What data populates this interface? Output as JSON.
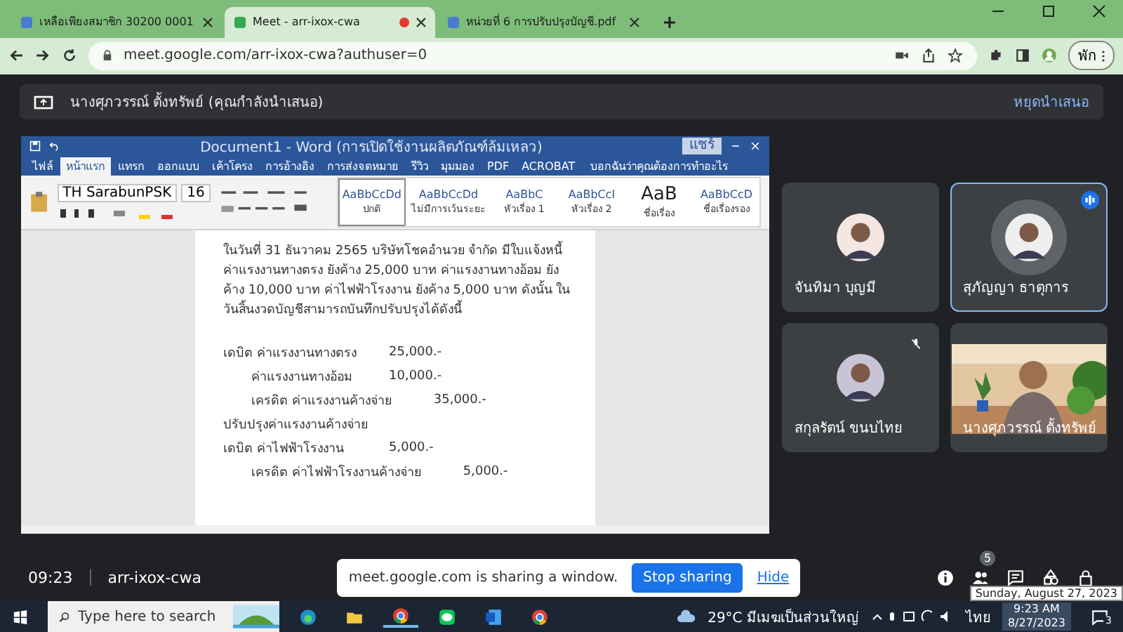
{
  "browser": {
    "tabs": [
      {
        "title": "เหลือเพียงสมาชิก 30200 0001",
        "selected": false,
        "recording": false
      },
      {
        "title": "Meet - arr-ixox-cwa",
        "selected": true,
        "recording": true
      },
      {
        "title": "หน่วยที่ 6 การปรับปรุงบัญชี.pdf",
        "selected": false,
        "recording": false
      }
    ],
    "url": "meet.google.com/arr-ixox-cwa?authuser=0",
    "profile_button": "พัก"
  },
  "presenting_banner": {
    "text": "นางศุภวรรณ์ ตั้งทรัพย์ (คุณกำลังนำเสนอ)",
    "stop": "หยุดนำเสนอ"
  },
  "word": {
    "title": "Document1 - Word (การเปิดใช้งานผลิตภัณฑ์ล้มเหลว)",
    "share_button": "แชร์",
    "tabs": [
      {
        "label": "ไฟล์",
        "selected": false
      },
      {
        "label": "หน้าแรก",
        "selected": true
      },
      {
        "label": "แทรก",
        "selected": false
      },
      {
        "label": "ออกแบบ",
        "selected": false
      },
      {
        "label": "เค้าโครง",
        "selected": false
      },
      {
        "label": "การอ้างอิง",
        "selected": false
      },
      {
        "label": "การส่งจดหมาย",
        "selected": false
      },
      {
        "label": "รีวิว",
        "selected": false
      },
      {
        "label": "มุมมอง",
        "selected": false
      },
      {
        "label": "PDF",
        "selected": false
      },
      {
        "label": "ACROBAT",
        "selected": false
      }
    ],
    "tell_me": "บอกฉันว่าคุณต้องการทำอะไร",
    "font": "TH SarabunPSK",
    "size": "16",
    "styles": [
      {
        "sample": "AaBbCcDd",
        "name": "ปกติ",
        "selected": true
      },
      {
        "sample": "AaBbCcDd",
        "name": "ไม่มีการเว้นระยะ",
        "selected": false
      },
      {
        "sample": "AaBbC",
        "name": "หัวเรื่อง 1",
        "selected": false
      },
      {
        "sample": "AaBbCcI",
        "name": "หัวเรื่อง 2",
        "selected": false
      },
      {
        "sample": "AaB",
        "name": "ชื่อเรื่อง",
        "selected": false
      },
      {
        "sample": "AaBbCcD",
        "name": "ชื่อเรื่องรอง",
        "selected": false
      }
    ],
    "paragraph": "ในวันที่ 31 ธันวาคม 2565 บริษัทโชคอำนวย จำกัด มีใบแจ้งหนี้ค่าแรงงานทางตรง ยังค้าง 25,000 บาท ค่าแรงงานทางอ้อม ยังค้าง 10,000 บาท ค่าไฟฟ้าโรงงาน ยังค้าง 5,000 บาท ดังนั้น ในวันสิ้นงวดบัญชีสามารถบันทึกปรับปรุงได้ดังนี้",
    "entries": [
      {
        "kind": "debit",
        "label": "เดบิต ค่าแรงงานทางตรง",
        "amount": "25,000.-"
      },
      {
        "kind": "sub",
        "label": "ค่าแรงงานทางอ้อม",
        "amount": "10,000.-"
      },
      {
        "kind": "credit",
        "label": "เครดิต ค่าแรงงานค้างจ่าย",
        "amount": "35,000.-"
      },
      {
        "kind": "text",
        "label": "ปรับปรุงค่าแรงงานค้างจ่าย"
      },
      {
        "kind": "debit",
        "label": "เดบิต ค่าไฟฟ้าโรงงาน",
        "amount": "5,000.-"
      },
      {
        "kind": "credit",
        "label": "เครดิต ค่าไฟฟ้าโรงงานค้างจ่าย",
        "amount": "5,000.-"
      }
    ]
  },
  "participants": [
    {
      "name": "จันทิมา บุญมี",
      "kind": "avatar",
      "speaking": false,
      "muted": false
    },
    {
      "name": "สุภัญญา ธาตุการ",
      "kind": "avatar",
      "speaking": true,
      "muted": false
    },
    {
      "name": "สกุลรัตน์ ขนบไทย",
      "kind": "avatar",
      "speaking": false,
      "muted": true
    },
    {
      "name": "นางศุภวรรณ์ ตั้งทรัพย์",
      "kind": "video",
      "speaking": false,
      "muted": false
    }
  ],
  "bottom_bar": {
    "time": "09:23",
    "code": "arr-ixox-cwa",
    "people_count": "5",
    "tooltip": "Sunday, August 27, 2023"
  },
  "share_notice": {
    "message": "meet.google.com is sharing a window.",
    "stop": "Stop sharing",
    "hide": "Hide"
  },
  "taskbar": {
    "search_placeholder": "Type here to search",
    "weather": "29°C มีเมฆเป็นส่วนใหญ่",
    "language": "ไทย",
    "time": "9:23 AM",
    "date": "8/27/2023",
    "notifications": "3"
  }
}
